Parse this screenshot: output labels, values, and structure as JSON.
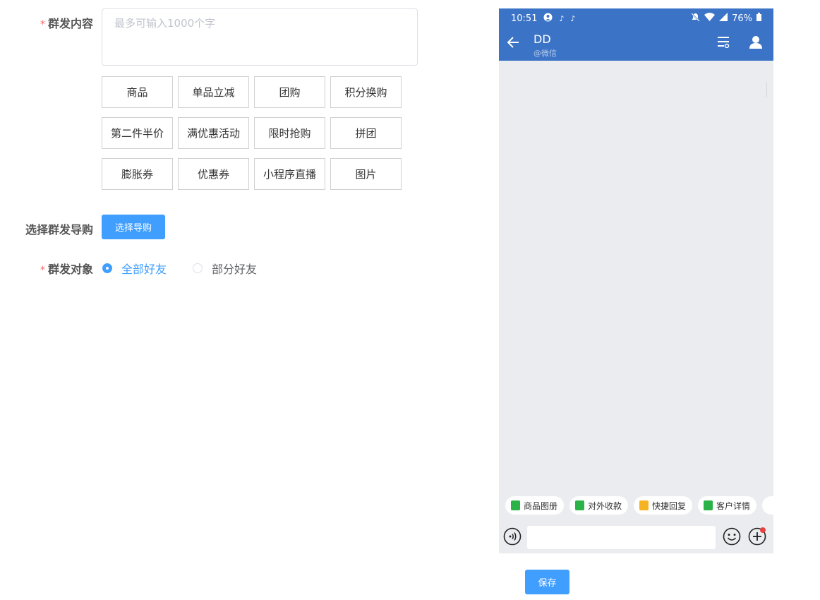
{
  "form": {
    "content_label": "群发内容",
    "required_mark": "*",
    "content_placeholder": "最多可输入1000个字",
    "content_value": "",
    "type_buttons": [
      "商品",
      "单品立减",
      "团购",
      "积分换购",
      "第二件半价",
      "满优惠活动",
      "限时抢购",
      "拼团",
      "膨胀券",
      "优惠券",
      "小程序直播",
      "图片"
    ],
    "guide_label": "选择群发导购",
    "guide_button": "选择导购",
    "target_label": "群发对象",
    "target_options": [
      {
        "label": "全部好友",
        "selected": true
      },
      {
        "label": "部分好友",
        "selected": false
      }
    ]
  },
  "phone": {
    "status": {
      "time": "10:51",
      "battery": "76%"
    },
    "chat": {
      "name": "DD",
      "sub": "@微信"
    },
    "quick_chips": [
      {
        "label": "商品图册",
        "icon": "album-icon",
        "color": "#2bb34a"
      },
      {
        "label": "对外收款",
        "icon": "payment-icon",
        "color": "#2bb34a"
      },
      {
        "label": "快捷回复",
        "icon": "quick-reply-icon",
        "color": "#f5b324"
      },
      {
        "label": "客户详情",
        "icon": "customer-icon",
        "color": "#2bb34a"
      },
      {
        "label": "",
        "icon": "more-icon",
        "color": "#ffffff"
      }
    ],
    "input_value": ""
  },
  "save_button": "保存",
  "colors": {
    "primary": "#409eff",
    "phone_header": "#3b73c7",
    "required": "#f56c6c",
    "chat_bg": "#ebecef"
  }
}
